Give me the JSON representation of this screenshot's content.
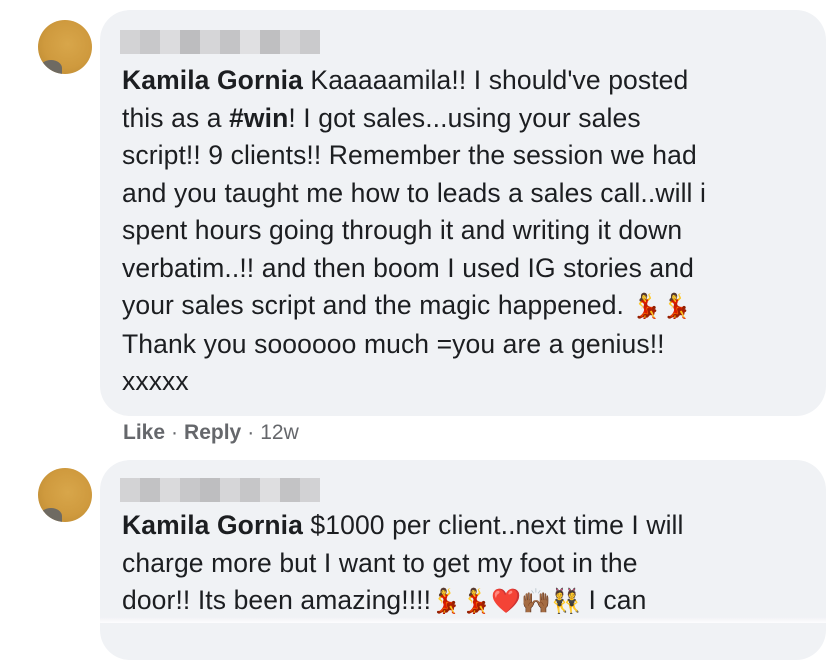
{
  "comments": [
    {
      "author": "Kamila Gornia",
      "segments": [
        {
          "text": " Kaaaaamila!! I should've posted\nthis as a "
        },
        {
          "text": "#win",
          "bold": true
        },
        {
          "text": "! I got sales...using your sales\nscript!! 9 clients!! Remember the session we had\nand you taught me how to leads a sales call..will i\nspent hours going through it and writing it down\nverbatim..!! and then boom I used IG stories and\nyour sales script and the magic happened. "
        },
        {
          "text": "💃💃",
          "emoji": true
        },
        {
          "text": "\nThank you soooooo much =you are a genius!!\nxxxxx"
        }
      ],
      "actions": {
        "like": "Like",
        "reply": "Reply",
        "separator": "·",
        "time": "12w"
      }
    },
    {
      "author": "Kamila Gornia",
      "segments": [
        {
          "text": " $1000 per client..next time I will\ncharge more but I want to get my foot in the\ndoor!! Its been amazing!!!!"
        },
        {
          "text": "💃💃❤️🙌🏾👯",
          "emoji": true
        },
        {
          "text": " I can"
        }
      ]
    }
  ],
  "colors": {
    "bubble_bg": "#f0f2f5",
    "text": "#1c1e21",
    "meta": "#65676b",
    "avatar": "#cf9a3e"
  },
  "icons": {
    "avatar": "profile-avatar",
    "blurred_name": "pixelated-redaction"
  }
}
